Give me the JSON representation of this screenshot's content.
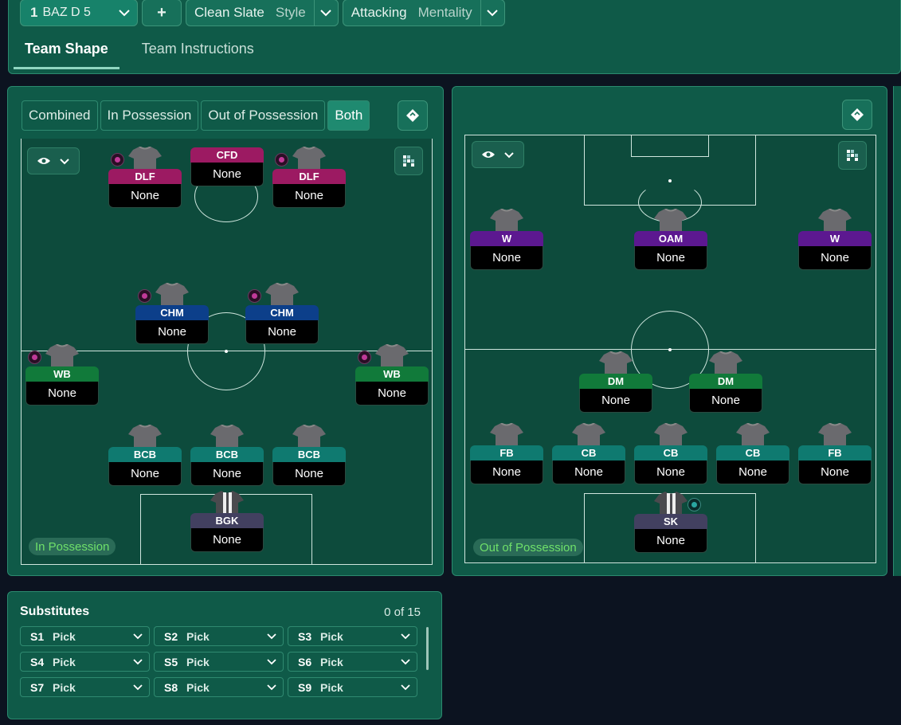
{
  "header": {
    "tactic_number": "1",
    "tactic_name": "BAZ D 5",
    "add_label": "+",
    "style_value": "Clean Slate",
    "style_label": "Style",
    "mentality_value": "Attacking",
    "mentality_label": "Mentality"
  },
  "tabs": [
    {
      "label": "Team Shape"
    },
    {
      "label": "Team Instructions"
    }
  ],
  "phase_toggle": [
    {
      "label": "Combined"
    },
    {
      "label": "In Possession"
    },
    {
      "label": "Out of Possession"
    },
    {
      "label": "Both"
    }
  ],
  "left_pitch": {
    "phase_label": "In Possession",
    "players": [
      {
        "role": "CFD",
        "name": "None"
      },
      {
        "role": "DLF",
        "name": "None"
      },
      {
        "role": "DLF",
        "name": "None"
      },
      {
        "role": "CHM",
        "name": "None"
      },
      {
        "role": "CHM",
        "name": "None"
      },
      {
        "role": "WB",
        "name": "None"
      },
      {
        "role": "WB",
        "name": "None"
      },
      {
        "role": "BCB",
        "name": "None"
      },
      {
        "role": "BCB",
        "name": "None"
      },
      {
        "role": "BCB",
        "name": "None"
      },
      {
        "role": "BGK",
        "name": "None"
      }
    ]
  },
  "right_pitch": {
    "phase_label": "Out of Possession",
    "players": [
      {
        "role": "W",
        "name": "None"
      },
      {
        "role": "OAM",
        "name": "None"
      },
      {
        "role": "W",
        "name": "None"
      },
      {
        "role": "DM",
        "name": "None"
      },
      {
        "role": "DM",
        "name": "None"
      },
      {
        "role": "FB",
        "name": "None"
      },
      {
        "role": "CB",
        "name": "None"
      },
      {
        "role": "CB",
        "name": "None"
      },
      {
        "role": "CB",
        "name": "None"
      },
      {
        "role": "FB",
        "name": "None"
      },
      {
        "role": "SK",
        "name": "None"
      }
    ]
  },
  "substitutes": {
    "title": "Substitutes",
    "count": "0 of 15",
    "slots": [
      {
        "id": "S1",
        "value": "Pick"
      },
      {
        "id": "S2",
        "value": "Pick"
      },
      {
        "id": "S3",
        "value": "Pick"
      },
      {
        "id": "S4",
        "value": "Pick"
      },
      {
        "id": "S5",
        "value": "Pick"
      },
      {
        "id": "S6",
        "value": "Pick"
      },
      {
        "id": "S7",
        "value": "Pick"
      },
      {
        "id": "S8",
        "value": "Pick"
      },
      {
        "id": "S9",
        "value": "Pick"
      }
    ]
  },
  "colors": {
    "panel": "#0f5a48",
    "pitch": "#0d4b3c",
    "striker_role": "#9c1a62",
    "midfield_role": "#0c3f8a",
    "wingback_role": "#117a3a",
    "defender_role": "#0f7a70",
    "keeper_role": "#424060",
    "attacking_mid_role": "#5c1890",
    "phase_label_text": "#6fe06a"
  }
}
